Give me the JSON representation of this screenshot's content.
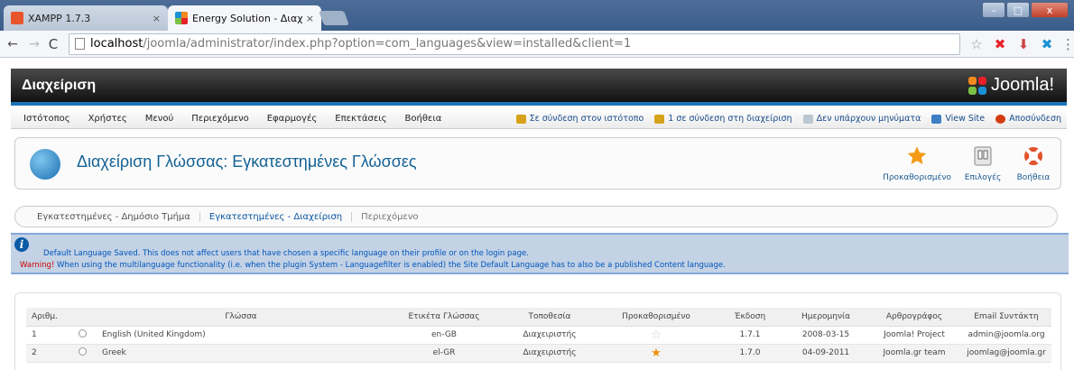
{
  "browser": {
    "tabs": [
      {
        "title": "XAMPP 1.7.3",
        "close": "×"
      },
      {
        "title": "Energy Solution - Διαχείρι",
        "close": "×"
      }
    ],
    "url_host": "localhost",
    "url_rest": "/joomla/administrator/index.php?option=com_languages&view=installed&client=1",
    "nav": {
      "back": "←",
      "forward": "→",
      "reload": "C"
    },
    "window_buttons": {
      "min": "–",
      "max": "□",
      "close": "x"
    }
  },
  "header": {
    "title": "Διαχείριση",
    "logo_text": "Joomla!"
  },
  "menu": {
    "items": [
      "Ιστότοπος",
      "Χρήστες",
      "Μενού",
      "Περιεχόμενο",
      "Εφαρμογές",
      "Επεκτάσεις",
      "Βοήθεια"
    ],
    "status": {
      "online_site": "Σε σύνδεση στον ιστότοπο",
      "online_admin": "1 σε σύνδεση στη διαχείριση",
      "messages": "Δεν υπάρχουν μηνύματα",
      "view_site": "View Site",
      "logout": "Αποσύνδεση"
    }
  },
  "titlebox": {
    "title": "Διαχείριση Γλώσσας: Εγκατεστημένες Γλώσσες",
    "buttons": {
      "default": "Προκαθορισμένο",
      "options": "Επιλογές",
      "help": "Βοήθεια"
    }
  },
  "submenu": [
    "Εγκατεστημένες - Δημόσιο Τμήμα",
    "Εγκατεστημένες - Διαχείριση",
    "Περιεχόμενο"
  ],
  "message": {
    "line1": "Default Language Saved. This does not affect users that have chosen a specific language on their profile or on the login page.",
    "warning_label": "Warning!",
    "line2": " When using the multilanguage functionality (i.e. when the plugin System - Languagefilter is enabled) the Site Default Language has to also be a published Content language."
  },
  "table": {
    "headers": [
      "Αριθμ.",
      "",
      "Γλώσσα",
      "Ετικέτα Γλώσσας",
      "Τοποθεσία",
      "Προκαθορισμένο",
      "Έκδοση",
      "Ημερομηνία",
      "Αρθρογράφος",
      "Email Συντάκτη"
    ],
    "rows": [
      {
        "num": "1",
        "language": "English (United Kingdom)",
        "tag": "en-GB",
        "location": "Διαχειριστής",
        "default": false,
        "version": "1.7.1",
        "date": "2008-03-15",
        "author": "Joomla! Project",
        "email": "admin@joomla.org"
      },
      {
        "num": "2",
        "language": "Greek",
        "tag": "el-GR",
        "location": "Διαχειριστής",
        "default": true,
        "version": "1.7.0",
        "date": "04-09-2011",
        "author": "Joomla.gr team",
        "email": "joomlag@joomla.gr"
      }
    ]
  }
}
